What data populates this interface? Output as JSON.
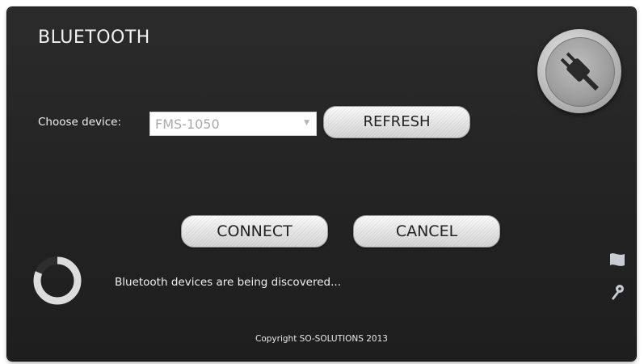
{
  "window": {
    "title": "BLUETOOTH"
  },
  "device": {
    "label": "Choose device:",
    "selected": "FMS-1050"
  },
  "buttons": {
    "refresh": "REFRESH",
    "connect": "CONNECT",
    "cancel": "CANCEL"
  },
  "status": {
    "message": "Bluetooth devices are being discovered..."
  },
  "footer": {
    "copyright": "Copyright SO-SOLUTIONS 2013"
  },
  "icons": {
    "plug": "plug-icon",
    "spinner": "loading-spinner-icon",
    "flag": "flag-icon",
    "key": "key-icon"
  },
  "colors": {
    "background": "#262626",
    "text": "#f0f0f0",
    "button": "#e6e6e6",
    "placeholder": "#a9a9a9"
  }
}
